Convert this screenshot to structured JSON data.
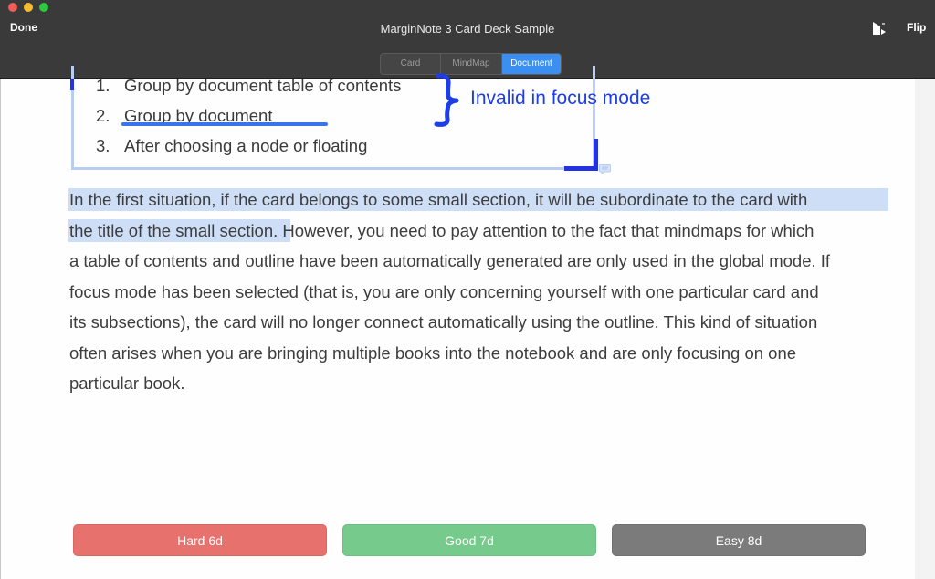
{
  "window": {
    "title": "MarginNote 3 Card Deck Sample",
    "done_label": "Done",
    "flip_label": "Flip",
    "flip_icon": "flip-card-icon"
  },
  "tabs": [
    {
      "label": "Card",
      "active": false
    },
    {
      "label": "MindMap",
      "active": false
    },
    {
      "label": "Document",
      "active": true
    }
  ],
  "document": {
    "list_items": [
      {
        "number": "1.",
        "text": "Group by document table of contents"
      },
      {
        "number": "2.",
        "text": "Group by document"
      },
      {
        "number": "3.",
        "text": "After choosing a node or floating"
      }
    ],
    "annotation": "Invalid in focus mode",
    "paragraph_lines": [
      "In the first situation, if the card belongs to some small section, it will be subordinate to the card with",
      "the title of the small section",
      ". However, you need to pay attention to the fact that mindmaps for which",
      "a table of contents and outline have been automatically generated are only used in the global mode. If",
      "focus mode has been selected (that is, you are only concerning yourself with one particular card and",
      "its subsections), the card will no longer connect automatically using the outline. This kind of situation",
      "often arises when you are bringing multiple books into the notebook and are only focusing on one",
      "particular book."
    ],
    "highlight_color": "#cedef7",
    "annotation_color": "#1d3ee6"
  },
  "answers": {
    "hard": "Hard 6d",
    "good": "Good 7d",
    "easy": "Easy 8d",
    "colors": {
      "hard": "#e6716d",
      "good": "#76cb8c",
      "easy": "#7b7b7b"
    }
  }
}
